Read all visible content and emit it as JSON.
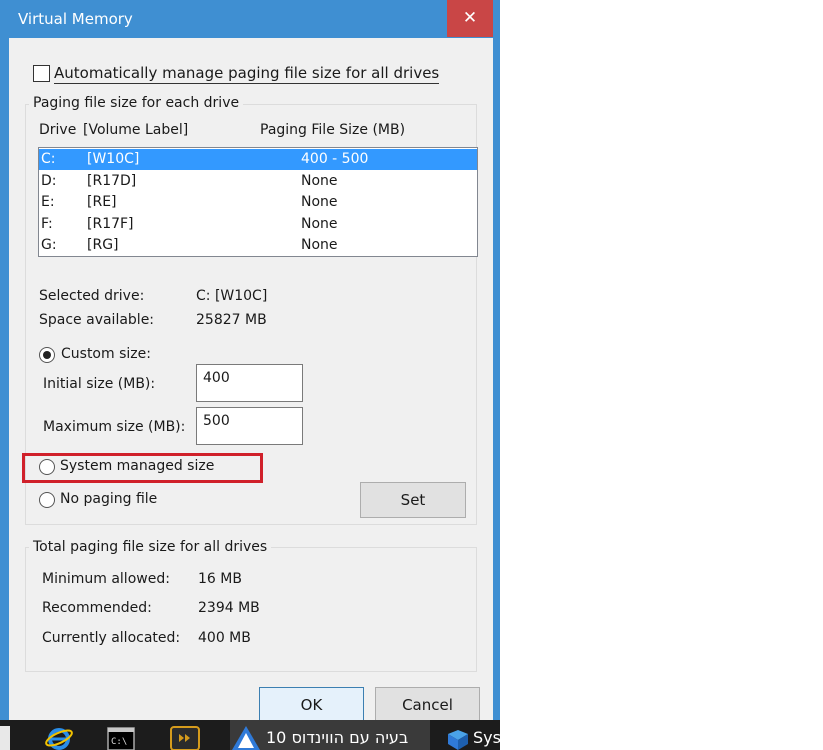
{
  "window": {
    "title": "Virtual Memory",
    "close_glyph": "✕"
  },
  "auto_manage": {
    "label": "Automatically manage paging file size for all drives",
    "checked": false
  },
  "paging_group": {
    "title": "Paging file size for each drive",
    "columns": {
      "drive": "Drive",
      "volume": "[Volume Label]",
      "size": "Paging File Size (MB)"
    },
    "drives": [
      {
        "letter": "C:",
        "label": "[W10C]",
        "size": "400 - 500",
        "selected": true
      },
      {
        "letter": "D:",
        "label": "[R17D]",
        "size": "None",
        "selected": false
      },
      {
        "letter": "E:",
        "label": "[RE]",
        "size": "None",
        "selected": false
      },
      {
        "letter": "F:",
        "label": "[R17F]",
        "size": "None",
        "selected": false
      },
      {
        "letter": "G:",
        "label": "[RG]",
        "size": "None",
        "selected": false
      }
    ],
    "selected_drive_label": "Selected drive:",
    "selected_drive_value": "C:  [W10C]",
    "space_label": "Space available:",
    "space_value": "25827 MB",
    "custom_size": {
      "label": "Custom size:",
      "selected": true
    },
    "initial": {
      "label": "Initial size (MB):",
      "value": "400"
    },
    "maximum": {
      "label": "Maximum size (MB):",
      "value": "500"
    },
    "system_managed": {
      "label": "System managed size",
      "selected": false
    },
    "no_paging": {
      "label": "No paging file",
      "selected": false
    },
    "set_label": "Set"
  },
  "total_group": {
    "title": "Total paging file size for all drives",
    "min_label": "Minimum allowed:",
    "min_value": "16 MB",
    "rec_label": "Recommended:",
    "rec_value": "2394 MB",
    "cur_label": "Currently allocated:",
    "cur_value": "400 MB"
  },
  "buttons": {
    "ok": "OK",
    "cancel": "Cancel"
  },
  "taskbar": {
    "app_title": "10 בעיה עם הווינדוס",
    "next_app": "Syst"
  },
  "colors": {
    "accent": "#3f8fd2",
    "selection": "#3399ff",
    "close": "#c94646",
    "highlight": "#d0202a"
  }
}
